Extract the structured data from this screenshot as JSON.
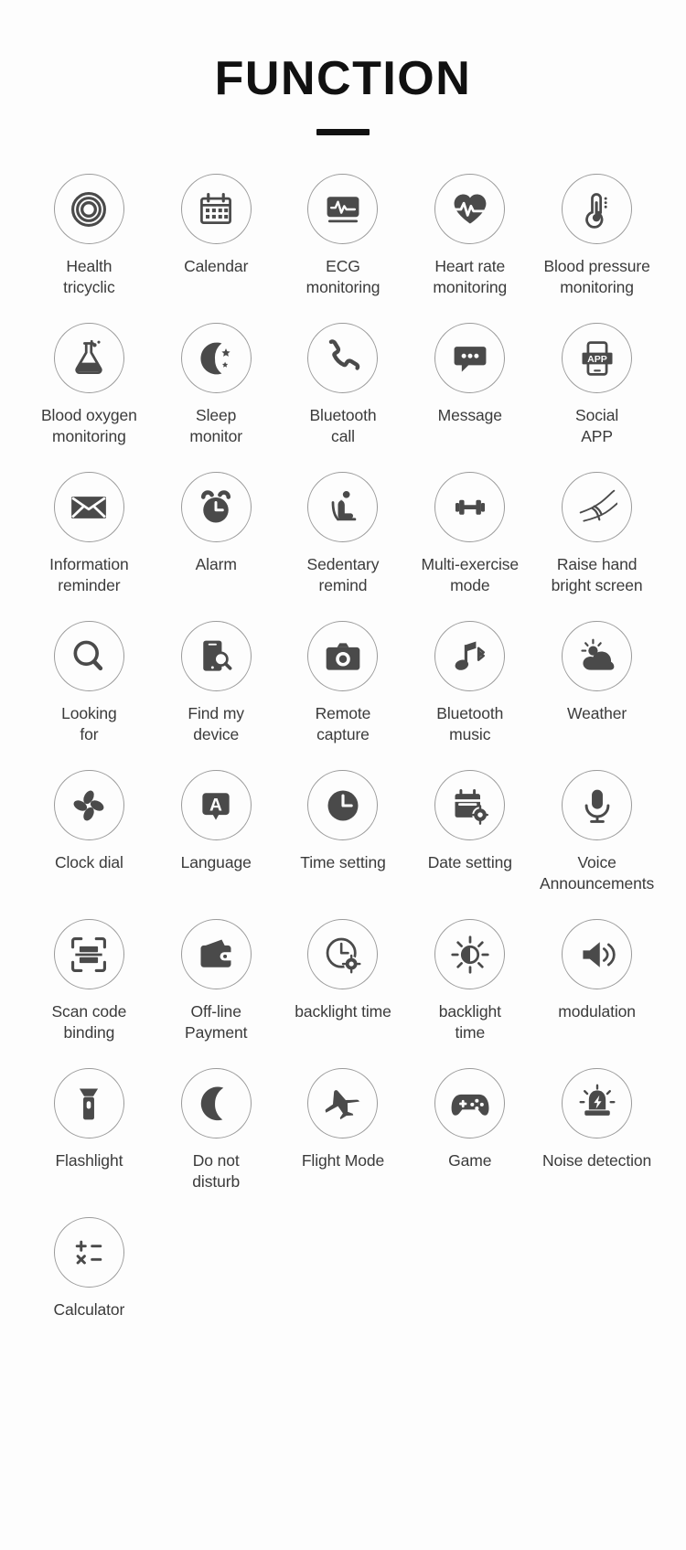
{
  "header": {
    "title": "FUNCTION"
  },
  "colors": {
    "icon": "#4a4a4a",
    "circle_border": "#9a9a9a",
    "text": "#3b3b3b",
    "title": "#111111",
    "background": "#fdfdfd"
  },
  "features": [
    {
      "label": "Health\ntricyclic",
      "icon": "health-tricyclic-icon"
    },
    {
      "label": "Calendar",
      "icon": "calendar-icon"
    },
    {
      "label": "ECG\nmonitoring",
      "icon": "ecg-monitor-icon"
    },
    {
      "label": "Heart rate\nmonitoring",
      "icon": "heart-rate-icon"
    },
    {
      "label": "Blood pressure\nmonitoring",
      "icon": "thermometer-icon"
    },
    {
      "label": "Blood oxygen\nmonitoring",
      "icon": "flask-icon"
    },
    {
      "label": "Sleep\nmonitor",
      "icon": "moon-stars-icon"
    },
    {
      "label": "Bluetooth\ncall",
      "icon": "phone-handset-icon"
    },
    {
      "label": "Message",
      "icon": "message-bubble-icon"
    },
    {
      "label": "Social\nAPP",
      "icon": "social-app-icon"
    },
    {
      "label": "Information\nreminder",
      "icon": "envelope-icon"
    },
    {
      "label": "Alarm",
      "icon": "alarm-clock-icon"
    },
    {
      "label": "Sedentary\nremind",
      "icon": "sedentary-person-icon"
    },
    {
      "label": "Multi-exercise\nmode",
      "icon": "dumbbell-icon"
    },
    {
      "label": "Raise hand\nbright screen",
      "icon": "raise-hand-wrist-icon"
    },
    {
      "label": "Looking\nfor",
      "icon": "magnifier-icon"
    },
    {
      "label": "Find my\ndevice",
      "icon": "find-phone-icon"
    },
    {
      "label": "Remote\ncapture",
      "icon": "camera-icon"
    },
    {
      "label": "Bluetooth\nmusic",
      "icon": "bluetooth-music-icon"
    },
    {
      "label": "Weather",
      "icon": "sun-cloud-icon"
    },
    {
      "label": "Clock dial",
      "icon": "pinwheel-icon"
    },
    {
      "label": "Language",
      "icon": "language-a-icon"
    },
    {
      "label": "Time setting",
      "icon": "clock-icon"
    },
    {
      "label": "Date setting",
      "icon": "calendar-gear-icon"
    },
    {
      "label": "Voice\nAnnouncements",
      "icon": "microphone-icon"
    },
    {
      "label": "Scan code\nbinding",
      "icon": "scan-code-icon"
    },
    {
      "label": "Off-line\nPayment",
      "icon": "wallet-icon"
    },
    {
      "label": "backlight time",
      "icon": "clock-gear-icon"
    },
    {
      "label": "backlight\ntime",
      "icon": "brightness-icon"
    },
    {
      "label": "modulation",
      "icon": "speaker-volume-icon"
    },
    {
      "label": "Flashlight",
      "icon": "flashlight-icon"
    },
    {
      "label": "Do not\ndisturb",
      "icon": "crescent-moon-icon"
    },
    {
      "label": "Flight Mode",
      "icon": "airplane-icon"
    },
    {
      "label": "Game",
      "icon": "gamepad-icon"
    },
    {
      "label": "Noise detection",
      "icon": "siren-icon"
    },
    {
      "label": "Calculator",
      "icon": "calculator-icon"
    }
  ]
}
